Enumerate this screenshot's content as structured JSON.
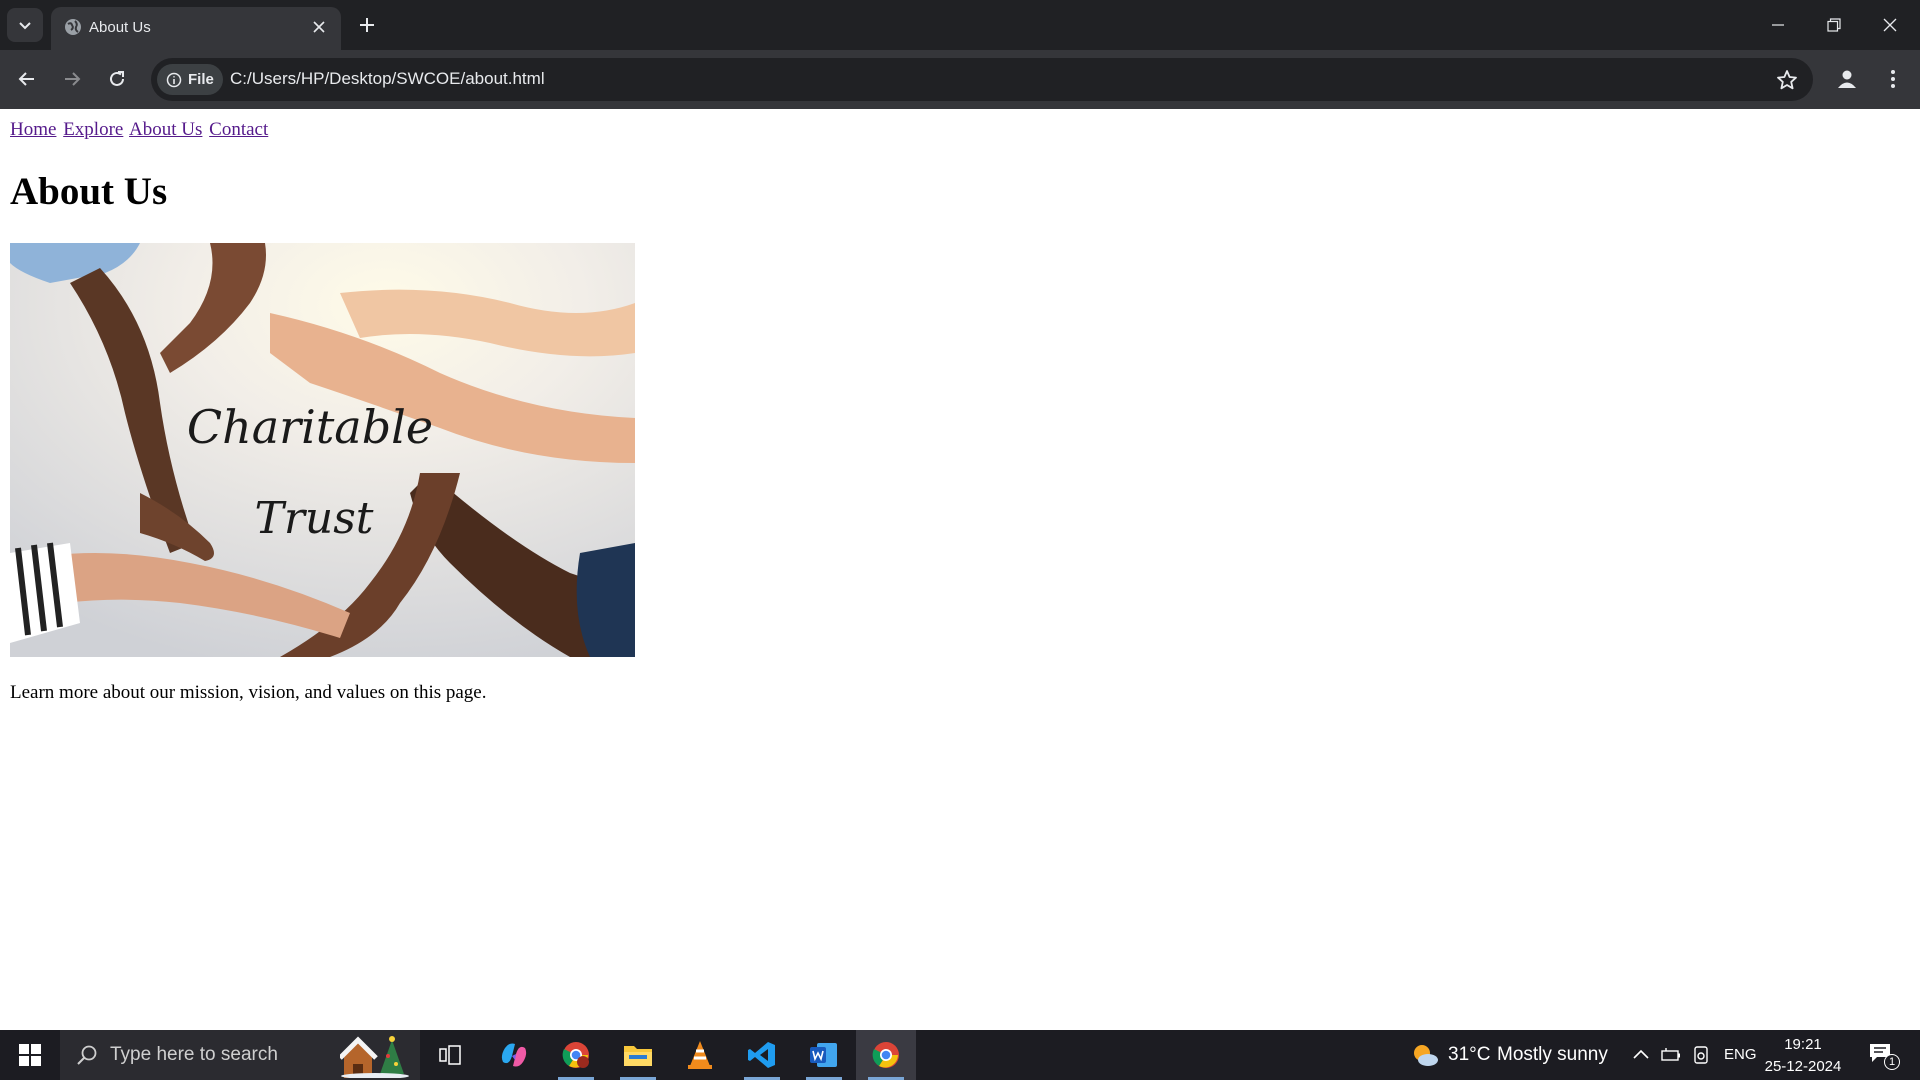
{
  "browser": {
    "tab_title": "About Us",
    "chip_label": "File",
    "url": "C:/Users/HP/Desktop/SWCOE/about.html"
  },
  "page": {
    "nav": [
      "Home",
      "Explore",
      "About Us",
      "Contact"
    ],
    "heading": "About Us",
    "hero_image_text": [
      "Charitable",
      "Trust"
    ],
    "description": "Learn more about our mission, vision, and values on this page."
  },
  "taskbar": {
    "search_placeholder": "Type here to search",
    "weather_temp": "31°C",
    "weather_text": "Mostly sunny",
    "language": "ENG",
    "time": "19:21",
    "date": "25-12-2024",
    "notification_count": "1",
    "apps": [
      "task-view",
      "copilot",
      "chrome-profile",
      "file-explorer",
      "vlc",
      "vs-code",
      "word",
      "chrome"
    ]
  },
  "colors": {
    "link": "#551a8b",
    "chrome_dark": "#202124",
    "chrome_mid": "#35363a"
  }
}
